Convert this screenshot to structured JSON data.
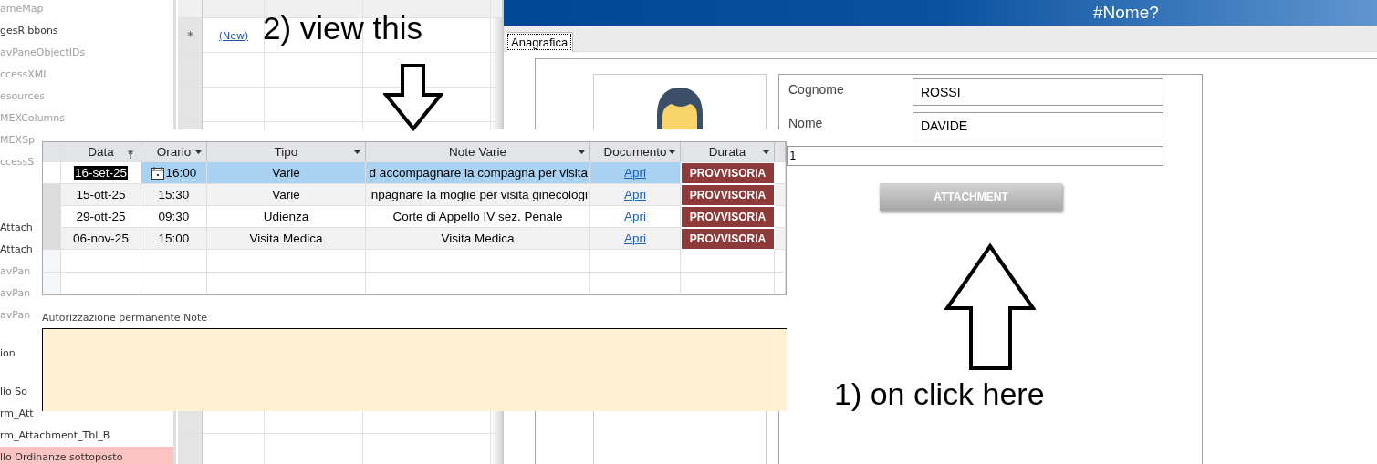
{
  "nav_pane": {
    "items": [
      {
        "label": "ameMap",
        "dimmed": true,
        "selected": false
      },
      {
        "label": "gesRibbons",
        "dimmed": false,
        "selected": false
      },
      {
        "label": "avPaneObjectIDs",
        "dimmed": true,
        "selected": false
      },
      {
        "label": "ccessXML",
        "dimmed": true,
        "selected": false
      },
      {
        "label": "esources",
        "dimmed": true,
        "selected": false
      },
      {
        "label": "MEXColumns",
        "dimmed": true,
        "selected": false
      },
      {
        "label": "MEXSp",
        "dimmed": true,
        "selected": false
      },
      {
        "label": "ccessS",
        "dimmed": true,
        "selected": false
      },
      {
        "label": "Attach",
        "dimmed": false,
        "selected": false
      },
      {
        "label": "Attach",
        "dimmed": false,
        "selected": false
      },
      {
        "label": "avPan",
        "dimmed": true,
        "selected": false
      },
      {
        "label": "avPan",
        "dimmed": true,
        "selected": false
      },
      {
        "label": "avPan",
        "dimmed": true,
        "selected": false
      },
      {
        "label": "ion",
        "dimmed": false,
        "selected": false
      },
      {
        "label": "lio So",
        "dimmed": false,
        "selected": false
      },
      {
        "label": "rm_Att",
        "dimmed": false,
        "selected": false
      },
      {
        "label": "rm_Attachment_Tbl_B",
        "dimmed": false,
        "selected": false
      },
      {
        "label": "llo Ordinanze sottoposto",
        "dimmed": false,
        "selected": true
      }
    ]
  },
  "background_table": {
    "new_row_marker": "*",
    "new_row_link": "(New)"
  },
  "form": {
    "title": "#Nome?",
    "tabs": [
      {
        "label": "Anagrafica",
        "selected": true
      }
    ],
    "fields": [
      {
        "label": "Cognome",
        "value": "ROSSI"
      },
      {
        "label": "Nome",
        "value": "DAVIDE"
      }
    ],
    "number_field": {
      "value": "1"
    },
    "button": "ATTACHMENT"
  },
  "subform": {
    "columns": [
      {
        "label": "Data",
        "sorted": true
      },
      {
        "label": "Orario",
        "sorted": false
      },
      {
        "label": "Tipo",
        "sorted": false
      },
      {
        "label": "Note Varie",
        "sorted": false
      },
      {
        "label": "Documento",
        "sorted": false
      },
      {
        "label": "Durata",
        "sorted": false
      }
    ],
    "rows": [
      {
        "data": "16-set-25",
        "orario": "16:00",
        "tipo": "Varie",
        "note": "d accompagnare la compagna per visita",
        "documento": "Apri",
        "durata": "PROVVISORIA",
        "selected": true
      },
      {
        "data": "15-ott-25",
        "orario": "15:30",
        "tipo": "Varie",
        "note": "npagnare la moglie per visita ginecologi",
        "documento": "Apri",
        "durata": "PROVVISORIA",
        "selected": false
      },
      {
        "data": "29-ott-25",
        "orario": "09:30",
        "tipo": "Udienza",
        "note": "Corte di Appello IV sez. Penale",
        "documento": "Apri",
        "durata": "PROVVISORIA",
        "selected": false
      },
      {
        "data": "06-nov-25",
        "orario": "15:00",
        "tipo": "Visita Medica",
        "note": "Visita Medica",
        "documento": "Apri",
        "durata": "PROVVISORIA",
        "selected": false
      }
    ],
    "memo": {
      "label": "Autorizzazione permanente Note"
    }
  },
  "annotations": [
    {
      "text": "2) view this"
    },
    {
      "text": "1) on click here"
    }
  ]
}
